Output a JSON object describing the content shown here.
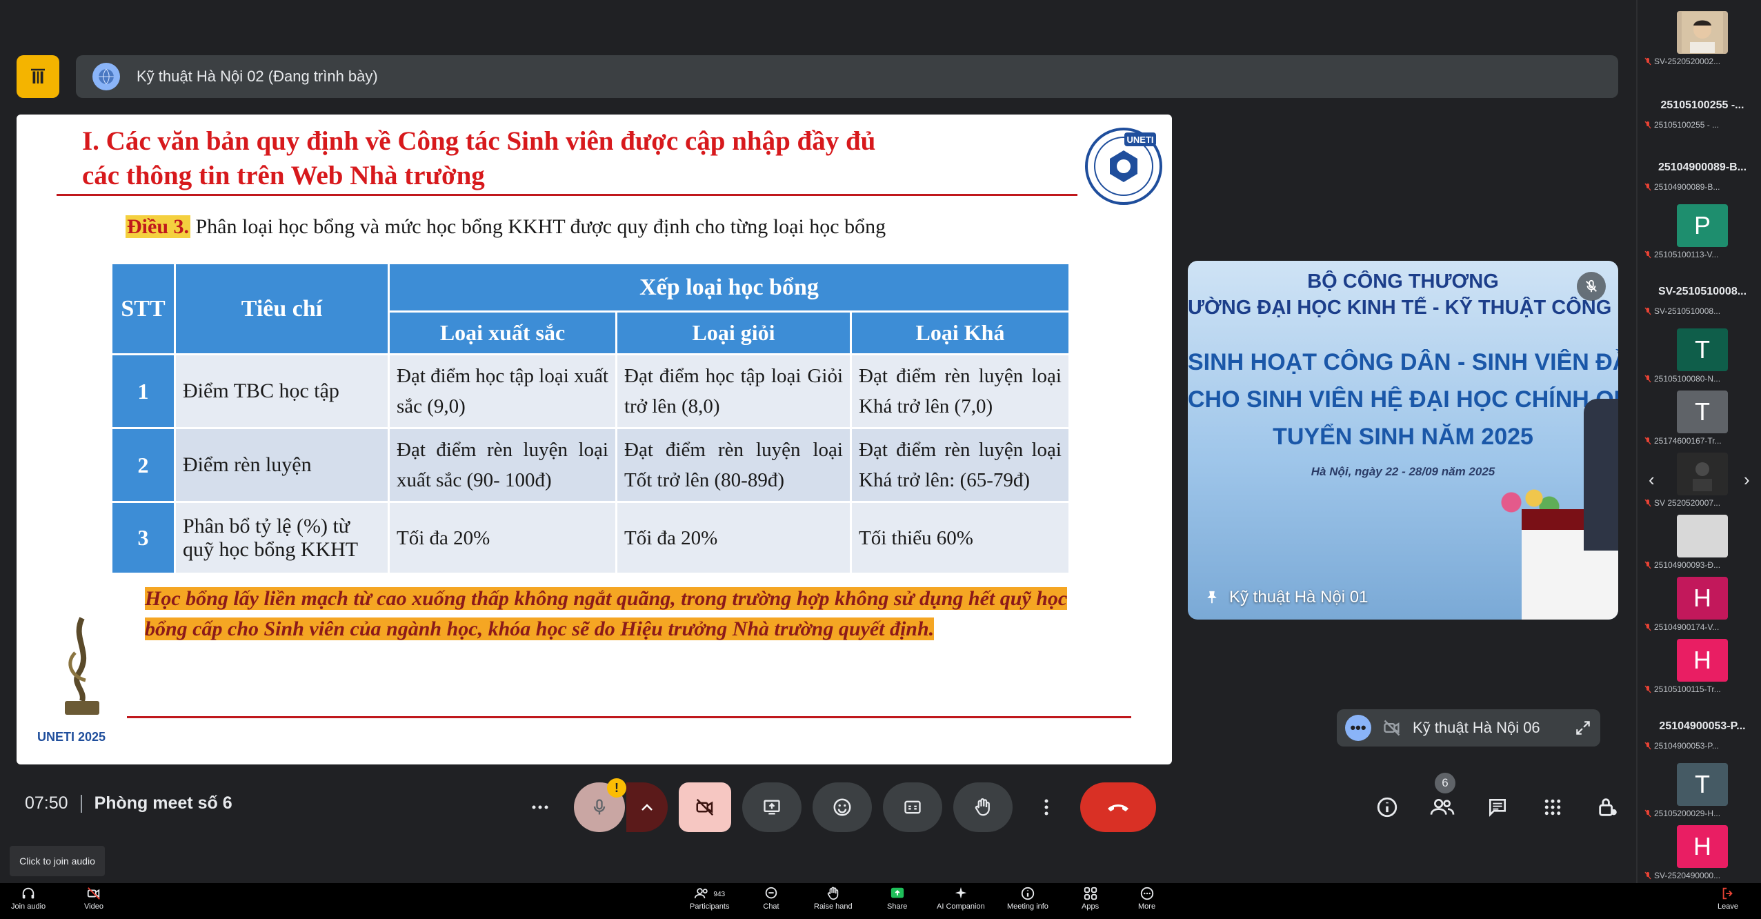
{
  "presenter_bar": {
    "name": "Kỹ thuật Hà Nội 02 (Đang trình bày)"
  },
  "slide": {
    "title_line1": "I. Các văn bản quy định về Công tác Sinh viên được cập nhập đầy đủ",
    "title_line2": "các thông tin trên Web Nhà trường",
    "logo_text": "UNETI",
    "dieu_label": "Điều 3.",
    "dieu_text": " Phân loại học bổng và mức học bổng KKHT được quy định cho từng loại học bổng",
    "table": {
      "col_stt": "STT",
      "col_criteria": "Tiêu chí",
      "col_group": "Xếp loại học bổng",
      "col_excellent": "Loại xuất sắc",
      "col_good": "Loại giỏi",
      "col_fair": "Loại Khá",
      "rows": [
        {
          "stt": "1",
          "criteria": "Điểm TBC học tập",
          "excellent": "Đạt điểm học tập loại xuất sắc (9,0)",
          "good": "Đạt điểm học tập loại Giỏi trở lên (8,0)",
          "fair": "Đạt điểm rèn luyện loại Khá trở lên (7,0)"
        },
        {
          "stt": "2",
          "criteria": "Điểm rèn luyện",
          "excellent": "Đạt điểm rèn luyện loại xuất sắc (90- 100đ)",
          "good": "Đạt điểm rèn luyện loại Tốt trở lên (80-89đ)",
          "fair": "Đạt điểm rèn luyện loại Khá trở lên: (65-79đ)"
        },
        {
          "stt": "3",
          "criteria": "Phân bổ tỷ lệ (%) từ quỹ học bổng KKHT",
          "excellent": "Tối đa 20%",
          "good": "Tối đa 20%",
          "fair": "Tối thiểu 60%"
        }
      ]
    },
    "note": "Học bổng lấy liền mạch từ cao xuống thấp không ngắt quãng, trong trường hợp không sử dụng hết quỹ học bổng  cấp cho Sinh viên của ngành học, khóa học sẽ do Hiệu trưởng Nhà trường quyết định.",
    "footer_brand": "UNETI 2025"
  },
  "video_tile": {
    "line1": "BỘ CÔNG THƯƠNG",
    "line2": "ƯỜNG ĐẠI HỌC KINH TẾ - KỸ THUẬT CÔNG NG",
    "line3": "SINH HOẠT CÔNG DÂN - SINH VIÊN ĐẦU KH",
    "line4": "CHO SINH VIÊN HỆ ĐẠI HỌC CHÍNH QUY K",
    "line5": "TUYỂN SINH NĂM 2025",
    "line6": "Hà Nội, ngày 22 - 28/09 năm 2025",
    "participant": "Kỹ thuật Hà Nội 01"
  },
  "mini_tile": {
    "participant": "Kỹ thuật Hà Nội 06"
  },
  "meeting": {
    "time": "07:50",
    "room": "Phòng meet số 6"
  },
  "controls": {
    "warning_badge": "!",
    "participants_count": "6"
  },
  "sidebar": {
    "items": [
      {
        "label": "SV-2520520002...",
        "avatar": ""
      },
      {
        "title": "25105100255 -...",
        "label": "25105100255 - ..."
      },
      {
        "title": "25104900089-B...",
        "label": "25104900089-B..."
      },
      {
        "avatar": "P",
        "label": "25105100113-V..."
      },
      {
        "title": "SV-2510510008...",
        "label": "SV-2510510008..."
      },
      {
        "avatar": "T",
        "label": "25105100080-N..."
      },
      {
        "avatar": "T",
        "label": "25174600167-Tr..."
      },
      {
        "avatar": "",
        "label": "SV 2520520007..."
      },
      {
        "avatar": "",
        "label": "25104900093-Đ..."
      },
      {
        "avatar": "H",
        "label": "25104900174-V..."
      },
      {
        "avatar": "H",
        "label": "25105100115-Tr..."
      },
      {
        "title": "25104900053-P...",
        "label": "25104900053-P..."
      },
      {
        "avatar": "T",
        "label": "25105200029-H..."
      },
      {
        "avatar": "H",
        "label": "SV-2520490000..."
      }
    ]
  },
  "tooltip": "Click to join audio",
  "bottom_bar": {
    "join_audio": "Join audio",
    "video": "Video",
    "participants": "Participants",
    "participants_count": "943",
    "chat": "Chat",
    "raise_hand": "Raise hand",
    "share": "Share",
    "ai_companion": "AI Companion",
    "meeting_info": "Meeting info",
    "apps": "Apps",
    "more": "More",
    "leave": "Leave"
  },
  "colors": {
    "accent_yellow": "#f4b400",
    "end_call_red": "#d93025",
    "table_header_blue": "#3d8dd6",
    "title_red": "#d7191c"
  }
}
